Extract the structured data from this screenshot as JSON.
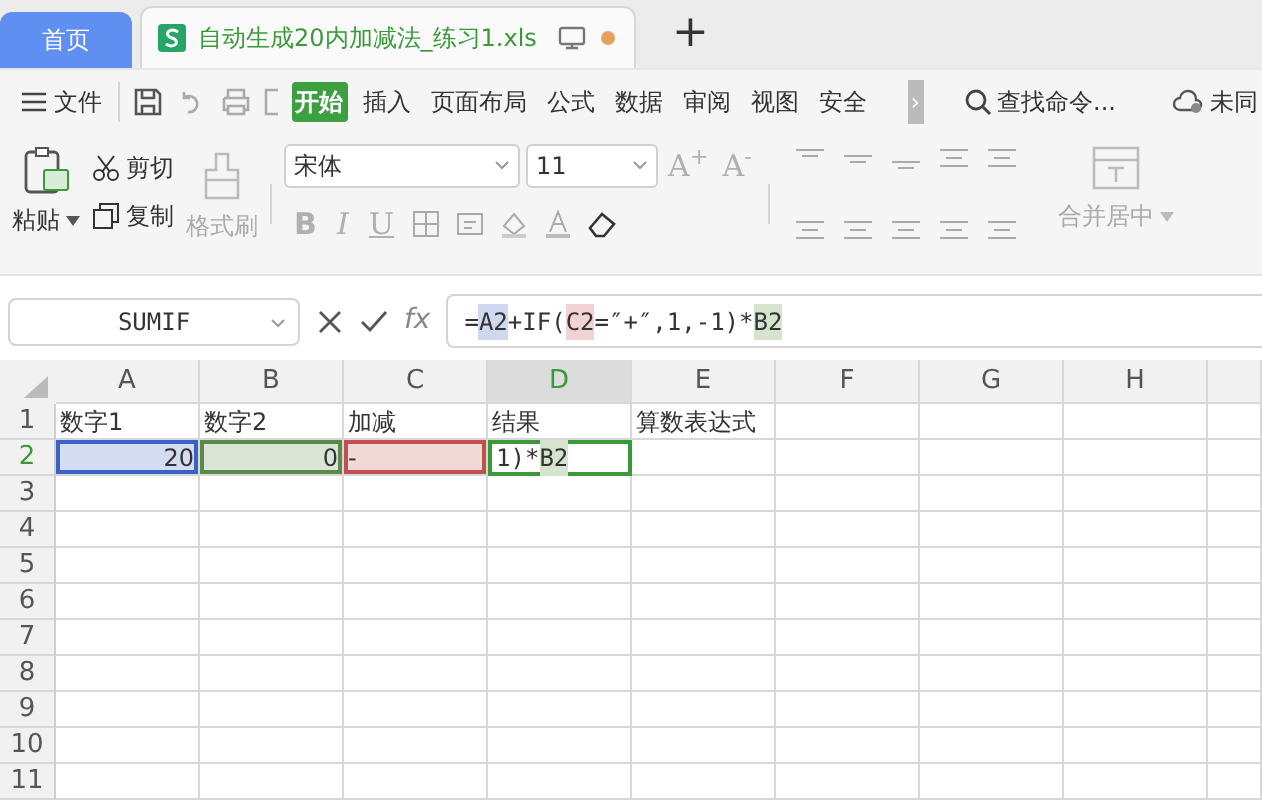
{
  "tabs": [
    {
      "label": "首页",
      "kind": "home",
      "selected": false
    },
    {
      "label": "自动生成20内加减法_练习1.xls",
      "kind": "document",
      "selected": true,
      "modified": true
    }
  ],
  "new_tab": "+",
  "menu": {
    "file": "文件",
    "items": [
      {
        "label": "开始",
        "selected": true
      },
      {
        "label": "插入",
        "selected": false
      },
      {
        "label": "页面布局",
        "selected": false
      },
      {
        "label": "公式",
        "selected": false
      },
      {
        "label": "数据",
        "selected": false
      },
      {
        "label": "审阅",
        "selected": false
      },
      {
        "label": "视图",
        "selected": false
      },
      {
        "label": "安全",
        "selected": false
      }
    ],
    "more": "›",
    "search": "查找命令...",
    "sync": "未同"
  },
  "ribbon": {
    "paste": "粘贴",
    "cut": "剪切",
    "copy": "复制",
    "format_painter": "格式刷",
    "font": "宋体",
    "size": "11",
    "grow": "A$^{+}$",
    "shrink": "A$^{-}$",
    "bold": "B",
    "italic": "I",
    "underline": "U",
    "merge": "合并居中"
  },
  "formula_bar": {
    "name_box": "SUMIF",
    "fx": "fx",
    "formula": [
      {
        "text": "="
      },
      {
        "text": "A2",
        "color": "#d0d8f0"
      },
      {
        "text": "+IF("
      },
      {
        "text": "C2",
        "color": "#f2d3d3"
      },
      {
        "text": "=″+″,1,-1)*"
      },
      {
        "text": "B2",
        "color": "#d6e3cf"
      }
    ]
  },
  "sheet": {
    "columns": [
      {
        "label": "A",
        "selected": false
      },
      {
        "label": "B",
        "selected": false
      },
      {
        "label": "C",
        "selected": false
      },
      {
        "label": "D",
        "selected": true
      },
      {
        "label": "E",
        "selected": false
      },
      {
        "label": "F",
        "selected": false
      },
      {
        "label": "G",
        "selected": false
      },
      {
        "label": "H",
        "selected": false
      }
    ],
    "rows": [
      {
        "label": "1",
        "selected": false,
        "cells": [
          {
            "text": "数字1"
          },
          {
            "text": "数字2"
          },
          {
            "text": "加减"
          },
          {
            "text": "结果"
          },
          {
            "text": "算数表达式"
          }
        ]
      },
      {
        "label": "2",
        "selected": true,
        "cells": [
          {
            "text": "20",
            "kind": "number",
            "color": "#3a62c4"
          },
          {
            "text": "0",
            "kind": "number",
            "color": "#5a8a4a"
          },
          {
            "text": "-",
            "color": "#c0504d"
          },
          {
            "kind": "editing",
            "segments": [
              {
                "text": "1)*"
              },
              {
                "text": "B2",
                "color": "#d6e3cf"
              }
            ]
          }
        ]
      },
      {
        "label": "3",
        "selected": false
      },
      {
        "label": "4",
        "selected": false
      },
      {
        "label": "5",
        "selected": false
      },
      {
        "label": "6",
        "selected": false
      },
      {
        "label": "7",
        "selected": false
      },
      {
        "label": "8",
        "selected": false
      },
      {
        "label": "9",
        "selected": false
      },
      {
        "label": "10",
        "selected": false
      },
      {
        "label": "11",
        "selected": false
      }
    ]
  }
}
